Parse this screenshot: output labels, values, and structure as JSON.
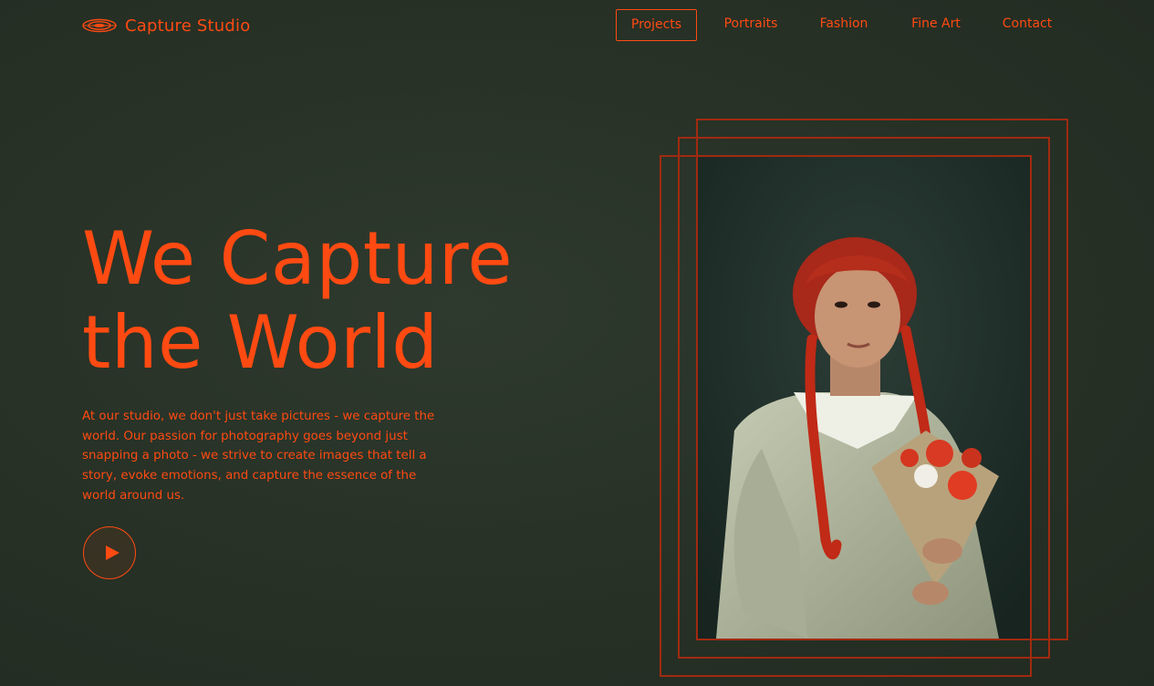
{
  "brand": {
    "name": "Capture Studio",
    "icon": "lens-logo-icon"
  },
  "nav": {
    "items": [
      {
        "label": "Projects",
        "active": true
      },
      {
        "label": "Portraits",
        "active": false
      },
      {
        "label": "Fashion",
        "active": false
      },
      {
        "label": "Fine Art",
        "active": false
      },
      {
        "label": "Contact",
        "active": false
      }
    ]
  },
  "hero": {
    "title_line1": "We Capture",
    "title_line2": "the World",
    "description": "At our studio, we don't just take pictures - we capture the world. Our passion for photography goes beyond just snapping a photo - we strive to create images that tell a story, evoke emotions, and capture the essence of the world around us.",
    "play_icon": "play-icon"
  },
  "colors": {
    "accent": "#ff4a12",
    "background": "#283226",
    "frame": "#a12a10"
  }
}
